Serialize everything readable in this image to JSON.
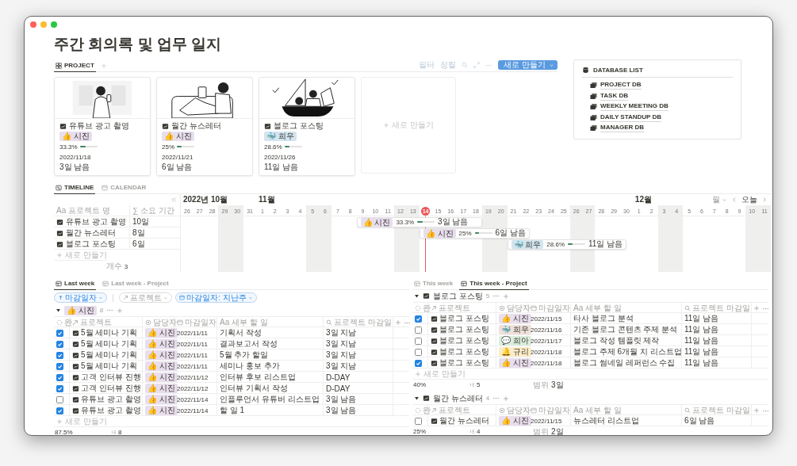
{
  "window": {
    "title": "주간 회의록 및 업무 일지"
  },
  "project_gallery": {
    "tabs": [
      {
        "label": "PROJECT",
        "selected": true
      }
    ],
    "toolbar": [
      "필터",
      "정렬"
    ],
    "new_button": "새로 만들기",
    "cards": [
      {
        "title": "유튜브 광고 촬영",
        "assignee": "👍 시진",
        "color": "#e8deee",
        "progress": "33.3%",
        "level": 0.333,
        "date": "2022/11/18",
        "remaining": "3일 남음"
      },
      {
        "title": "월간 뉴스레터",
        "assignee": "👍 시진",
        "color": "#e8deee",
        "progress": "25%",
        "level": 0.25,
        "date": "2022/11/21",
        "remaining": "6일 남음"
      },
      {
        "title": "블로그 포스팅",
        "assignee": "🐳 희우",
        "color": "#d3e5ef",
        "progress": "28.6%",
        "level": 0.286,
        "date": "2022/11/26",
        "remaining": "11일 남음"
      }
    ],
    "new_card": "새로 만들기"
  },
  "database_list": {
    "title": "DATABASE LIST",
    "items": [
      "PROJECT DB",
      "TASK DB",
      "WEEKLY MEETING DB",
      "DAILY STANDUP DB",
      "MANAGER DB"
    ]
  },
  "timeline": {
    "tabs": [
      {
        "label": "TIMELINE",
        "selected": true
      },
      {
        "label": "CALENDAR",
        "selected": false
      }
    ],
    "columns": [
      {
        "label": "Aa 프로젝트 명"
      },
      {
        "label": "∑ 소요 기간"
      }
    ],
    "rows": [
      {
        "name": "유튜브 광고 촬영",
        "duration": "10일"
      },
      {
        "name": "월간 뉴스레터",
        "duration": "8일"
      },
      {
        "name": "블로그 포스팅",
        "duration": "6일"
      }
    ],
    "new_row": "새로 만들기",
    "count_label": "개수",
    "count": "3",
    "scale": "월",
    "today_button": "오늘",
    "days": [
      {
        "label": "26",
        "month": "2022년 10월",
        "weekend": false,
        "today": false
      },
      {
        "label": "27",
        "weekend": false,
        "today": false
      },
      {
        "label": "28",
        "weekend": false,
        "today": false
      },
      {
        "label": "29",
        "weekend": true,
        "today": false
      },
      {
        "label": "30",
        "weekend": true,
        "today": false
      },
      {
        "label": "31",
        "weekend": false,
        "today": false
      },
      {
        "label": "1",
        "month": "11월",
        "weekend": false,
        "today": false
      },
      {
        "label": "2",
        "weekend": false,
        "today": false
      },
      {
        "label": "3",
        "weekend": false,
        "today": false
      },
      {
        "label": "4",
        "weekend": false,
        "today": false
      },
      {
        "label": "5",
        "weekend": true,
        "today": false
      },
      {
        "label": "6",
        "weekend": true,
        "today": false
      },
      {
        "label": "7",
        "weekend": false,
        "today": false
      },
      {
        "label": "8",
        "weekend": false,
        "today": false
      },
      {
        "label": "9",
        "weekend": false,
        "today": false
      },
      {
        "label": "10",
        "weekend": false,
        "today": false
      },
      {
        "label": "11",
        "weekend": false,
        "today": false
      },
      {
        "label": "12",
        "weekend": true,
        "today": false
      },
      {
        "label": "13",
        "weekend": true,
        "today": false
      },
      {
        "label": "14",
        "weekend": false,
        "today": true
      },
      {
        "label": "15",
        "weekend": false,
        "today": false
      },
      {
        "label": "16",
        "weekend": false,
        "today": false
      },
      {
        "label": "17",
        "weekend": false,
        "today": false
      },
      {
        "label": "18",
        "weekend": false,
        "today": false
      },
      {
        "label": "19",
        "weekend": true,
        "today": false
      },
      {
        "label": "20",
        "weekend": true,
        "today": false
      },
      {
        "label": "21",
        "weekend": false,
        "today": false
      },
      {
        "label": "22",
        "weekend": false,
        "today": false
      },
      {
        "label": "23",
        "weekend": false,
        "today": false
      },
      {
        "label": "24",
        "weekend": false,
        "today": false
      },
      {
        "label": "25",
        "weekend": false,
        "today": false
      },
      {
        "label": "26",
        "weekend": true,
        "today": false
      },
      {
        "label": "27",
        "weekend": true,
        "today": false
      },
      {
        "label": "28",
        "weekend": false,
        "today": false
      },
      {
        "label": "29",
        "weekend": false,
        "today": false
      },
      {
        "label": "30",
        "weekend": false,
        "today": false
      },
      {
        "label": "1",
        "month": "12월",
        "weekend": false,
        "today": false
      },
      {
        "label": "2",
        "weekend": false,
        "today": false
      },
      {
        "label": "3",
        "weekend": true,
        "today": false
      },
      {
        "label": "4",
        "weekend": true,
        "today": false
      },
      {
        "label": "5",
        "weekend": false,
        "today": false
      },
      {
        "label": "6",
        "weekend": false,
        "today": false
      },
      {
        "label": "7",
        "weekend": false,
        "today": false
      },
      {
        "label": "8",
        "weekend": false,
        "today": false
      },
      {
        "label": "9",
        "weekend": false,
        "today": false
      },
      {
        "label": "10",
        "weekend": true,
        "today": false
      },
      {
        "label": "11",
        "weekend": true,
        "today": false
      }
    ],
    "bars": [
      {
        "assignee": "👍 시진",
        "color": "#e8deee",
        "progress": "33.3%",
        "level": 0.333,
        "remaining": "3일 남음"
      },
      {
        "assignee": "👍 시진",
        "color": "#e8deee",
        "progress": "25%",
        "level": 0.25,
        "remaining": "6일 남음"
      },
      {
        "assignee": "🐳 희우",
        "color": "#d3e5ef",
        "progress": "28.6%",
        "level": 0.286,
        "remaining": "11일 남음"
      }
    ]
  },
  "last_week": {
    "tabs": [
      {
        "label": "Last week",
        "selected": true
      },
      {
        "label": "Last week - Project",
        "selected": false
      }
    ],
    "filters": [
      {
        "kind": "sort",
        "label": "마감일자",
        "active": true
      },
      {
        "kind": "relation",
        "label": "프로젝트",
        "active": false
      },
      {
        "kind": "date",
        "label": "마감일자: 지난주",
        "active": true
      }
    ],
    "groups": [
      {
        "kind": "tag",
        "label": "👍 시진",
        "color": "#e8deee",
        "count": "8",
        "columns": [
          {
            "kind": "status",
            "label": "완."
          },
          {
            "kind": "relation",
            "label": "프로젝트"
          },
          {
            "kind": "person",
            "label": "담당자"
          },
          {
            "kind": "date",
            "label": "마감일자"
          },
          {
            "kind": "title",
            "label": "Aa 세부 할 일"
          },
          {
            "kind": "formula",
            "label": "프로젝트 마감일"
          }
        ],
        "rows": [
          {
            "done": true,
            "project": "5월 세미나 기획",
            "assignee": "👍 시진",
            "color": "#e8deee",
            "due": "2022/11/11",
            "task": "기획서 작성",
            "project_due": "3일 지남"
          },
          {
            "done": true,
            "project": "5월 세미나 기획",
            "assignee": "👍 시진",
            "color": "#e8deee",
            "due": "2022/11/11",
            "task": "결과보고서 작성",
            "project_due": "3일 지남"
          },
          {
            "done": true,
            "project": "5월 세미나 기획",
            "assignee": "👍 시진",
            "color": "#e8deee",
            "due": "2022/11/11",
            "task": "5월 추가 할일",
            "project_due": "3일 지남"
          },
          {
            "done": true,
            "project": "5월 세미나 기획",
            "assignee": "👍 시진",
            "color": "#e8deee",
            "due": "2022/11/11",
            "task": "세미나 홍보 추가",
            "project_due": "3일 지남"
          },
          {
            "done": true,
            "project": "고객 인터뷰 진행",
            "assignee": "👍 시진",
            "color": "#e8deee",
            "due": "2022/11/12",
            "task": "인터뷰 후보 리스트업",
            "project_due": "D-DAY"
          },
          {
            "done": true,
            "project": "고객 인터뷰 진행",
            "assignee": "👍 시진",
            "color": "#e8deee",
            "due": "2022/11/12",
            "task": "인터뷰 기획서 작성",
            "project_due": "D-DAY"
          },
          {
            "done": false,
            "project": "유튜브 광고 촬영",
            "assignee": "👍 시진",
            "color": "#e8deee",
            "due": "2022/11/14",
            "task": "인플루언서 유튜버 리스트업",
            "project_due": "3일 남음"
          },
          {
            "done": true,
            "project": "유튜브 광고 촬영",
            "assignee": "👍 시진",
            "color": "#e8deee",
            "due": "2022/11/14",
            "task": "할 일 1",
            "project_due": "3일 남음"
          }
        ],
        "new_row": "새로 만들기",
        "summary": {
          "percent": "87.5%",
          "count": "8"
        }
      }
    ]
  },
  "this_week": {
    "tabs": [
      {
        "label": "This week",
        "selected": false
      },
      {
        "label": "This week - Project",
        "selected": true
      }
    ],
    "groups": [
      {
        "kind": "page",
        "label": "블로그 포스팅",
        "count": "5",
        "columns": [
          {
            "kind": "status",
            "label": "완"
          },
          {
            "kind": "relation",
            "label": "프로젝트"
          },
          {
            "kind": "person",
            "label": "담당자"
          },
          {
            "kind": "date",
            "label": "마감일자"
          },
          {
            "kind": "title",
            "label": "Aa 세부 할 일"
          },
          {
            "kind": "formula",
            "label": "프로젝트 마감일"
          }
        ],
        "rows": [
          {
            "done": true,
            "project": "블로그 포스팅",
            "assignee": "👍 시진",
            "color": "#e8deee",
            "due": "2022/11/15",
            "task": "타사 블로그 분석",
            "project_due": "11일 남음"
          },
          {
            "done": false,
            "project": "블로그 포스팅",
            "assignee": "🐳 희우",
            "color": "#eee0da",
            "due": "2022/11/16",
            "task": "기존 블로그 콘텐츠 주제 분석",
            "project_due": "11일 남음"
          },
          {
            "done": false,
            "project": "블로그 포스팅",
            "assignee": "💬 희아",
            "color": "#dbeddb",
            "due": "2022/11/17",
            "task": "블로그 작성 템플릿 제작",
            "project_due": "11일 남음"
          },
          {
            "done": false,
            "project": "블로그 포스팅",
            "assignee": "🔔 규리",
            "color": "#fdecc8",
            "due": "2022/11/18",
            "task": "블로그 주제 6개월 치 리스트업",
            "project_due": "11일 남음"
          },
          {
            "done": true,
            "project": "블로그 포스팅",
            "assignee": "👍 시진",
            "color": "#e8deee",
            "due": "2022/11/18",
            "task": "블로그 썸네일 레퍼런스 수집",
            "project_due": "11일 남음"
          }
        ],
        "new_row": "새로 만들기",
        "summary": {
          "percent": "40%",
          "count": "5",
          "range_label": "범위",
          "range": "3일"
        }
      },
      {
        "kind": "page",
        "label": "월간 뉴스레터",
        "count": "4",
        "columns": [
          {
            "kind": "status",
            "label": "완"
          },
          {
            "kind": "relation",
            "label": "프로젝트"
          },
          {
            "kind": "person",
            "label": "담당자"
          },
          {
            "kind": "date",
            "label": "마감일자"
          },
          {
            "kind": "title",
            "label": "Aa 세부 할 일"
          },
          {
            "kind": "formula",
            "label": "프로젝트 마감일"
          }
        ],
        "rows": [
          {
            "done": false,
            "project": "월간 뉴스레터",
            "assignee": "👍 시진",
            "color": "#e8deee",
            "due": "2022/11/15",
            "task": "뉴스레터 리스트업",
            "project_due": "6일 남음"
          }
        ],
        "summary": {
          "percent": "25%",
          "count": "4",
          "range_label": "범위",
          "range": "2일"
        }
      }
    ]
  }
}
